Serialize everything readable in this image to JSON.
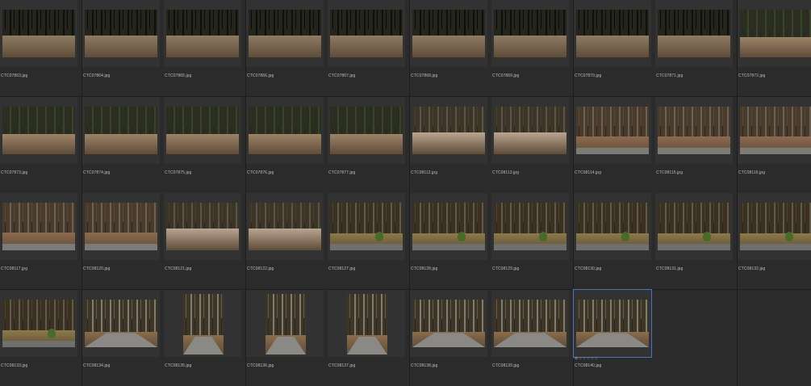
{
  "files": [
    {
      "name": "CTC07863.jpg",
      "scene": "forest-dark",
      "orient": "landscape"
    },
    {
      "name": "CTC07864.jpg",
      "scene": "forest-dark",
      "orient": "landscape"
    },
    {
      "name": "CTC07865.jpg",
      "scene": "forest-dark",
      "orient": "landscape"
    },
    {
      "name": "CTC07866.jpg",
      "scene": "forest-dark",
      "orient": "landscape"
    },
    {
      "name": "CTC07867.jpg",
      "scene": "forest-dark",
      "orient": "landscape"
    },
    {
      "name": "CTC07868.jpg",
      "scene": "forest-dark",
      "orient": "landscape"
    },
    {
      "name": "CTC07869.jpg",
      "scene": "forest-dark",
      "orient": "landscape"
    },
    {
      "name": "CTC07870.jpg",
      "scene": "forest-dark",
      "orient": "landscape"
    },
    {
      "name": "CTC07871.jpg",
      "scene": "forest-dark",
      "orient": "landscape"
    },
    {
      "name": "CTC07872.jpg",
      "scene": "forest-green",
      "orient": "landscape"
    },
    {
      "name": "CTC07873.jpg",
      "scene": "forest-green",
      "orient": "landscape"
    },
    {
      "name": "CTC07874.jpg",
      "scene": "forest-green",
      "orient": "landscape"
    },
    {
      "name": "CTC07875.jpg",
      "scene": "forest-green",
      "orient": "landscape"
    },
    {
      "name": "CTC07876.jpg",
      "scene": "forest-green",
      "orient": "landscape"
    },
    {
      "name": "CTC07877.jpg",
      "scene": "forest-green",
      "orient": "landscape"
    },
    {
      "name": "CTC08112.jpg",
      "scene": "forest-bright",
      "orient": "landscape"
    },
    {
      "name": "CTC08113.jpg",
      "scene": "forest-bright",
      "orient": "landscape"
    },
    {
      "name": "CTC08114.jpg",
      "scene": "forest-road-edge",
      "orient": "landscape"
    },
    {
      "name": "CTC08115.jpg",
      "scene": "forest-road-edge",
      "orient": "landscape"
    },
    {
      "name": "CTC08116.jpg",
      "scene": "forest-road-edge",
      "orient": "landscape"
    },
    {
      "name": "CTC08117.jpg",
      "scene": "forest-road-edge",
      "orient": "landscape"
    },
    {
      "name": "CTC08120.jpg",
      "scene": "forest-road-edge",
      "orient": "landscape"
    },
    {
      "name": "CTC08121.jpg",
      "scene": "forest-bright",
      "orient": "landscape"
    },
    {
      "name": "CTC08122.jpg",
      "scene": "forest-bright",
      "orient": "landscape"
    },
    {
      "name": "CTC08127.jpg",
      "scene": "road-bush",
      "orient": "landscape"
    },
    {
      "name": "CTC08128.jpg",
      "scene": "road-bush",
      "orient": "landscape"
    },
    {
      "name": "CTC08129.jpg",
      "scene": "road-bush",
      "orient": "landscape"
    },
    {
      "name": "CTC08130.jpg",
      "scene": "road-bush",
      "orient": "landscape"
    },
    {
      "name": "CTC08131.jpg",
      "scene": "road-bush",
      "orient": "landscape"
    },
    {
      "name": "CTC08132.jpg",
      "scene": "road-bush",
      "orient": "landscape"
    },
    {
      "name": "CTC08133.jpg",
      "scene": "road-bush",
      "orient": "landscape"
    },
    {
      "name": "CTC08134.jpg",
      "scene": "road-curve",
      "orient": "landscape"
    },
    {
      "name": "CTC08135.jpg",
      "scene": "road-curve",
      "orient": "portrait"
    },
    {
      "name": "CTC08136.jpg",
      "scene": "road-curve",
      "orient": "portrait"
    },
    {
      "name": "CTC08137.jpg",
      "scene": "road-curve",
      "orient": "portrait"
    },
    {
      "name": "CTC08138.jpg",
      "scene": "road-curve",
      "orient": "landscape"
    },
    {
      "name": "CTC08139.jpg",
      "scene": "road-curve",
      "orient": "landscape"
    },
    {
      "name": "CTC08140.jpg",
      "scene": "road-curve",
      "orient": "landscape",
      "selected": true,
      "rating": "☆☆☆☆☆",
      "rating_prefix": "⊘"
    }
  ],
  "colors": {
    "background": "#1d1d1d",
    "cell": "#2b2b2b",
    "thumb_frame": "#323232",
    "selection": "#4a74b8",
    "filename": "#bdbdbd"
  }
}
